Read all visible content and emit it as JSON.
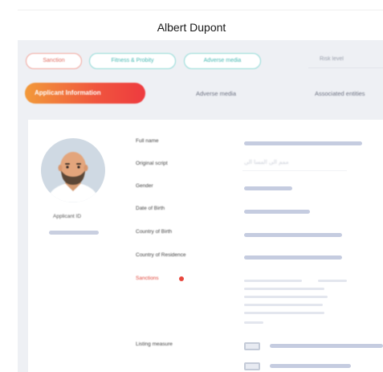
{
  "header": {
    "title": "Albert Dupont"
  },
  "filters": [
    {
      "label": "Sanction",
      "color": "#e06c60"
    },
    {
      "label": "Fitness & Probity",
      "color": "#46b8b2"
    },
    {
      "label": "Adverse media",
      "color": "#46b8b2"
    }
  ],
  "subtitle": "Risk level",
  "tabs": [
    {
      "label": "Applicant Information",
      "active": true
    },
    {
      "label": "Adverse media",
      "active": false
    },
    {
      "label": "Associated entities",
      "active": false
    }
  ],
  "profile": {
    "applicant_id": "Applicant ID"
  },
  "fields": {
    "full_name": "Full name",
    "original_script": "Original script",
    "original_script_value": "ممم الى المسا الى",
    "gender": "Gender",
    "date_of_birth": "Date of Birth",
    "country_of_birth": "Country of Birth",
    "country_of_residence": "Country of Residence",
    "sanctions": "Sanctions",
    "listing_measure": "Listing measure"
  },
  "colors": {
    "accent_gradient_start": "#f29a3a",
    "accent_gradient_end": "#ee3b3f",
    "teal": "#46b8b2",
    "alert_red": "#e8473d"
  }
}
